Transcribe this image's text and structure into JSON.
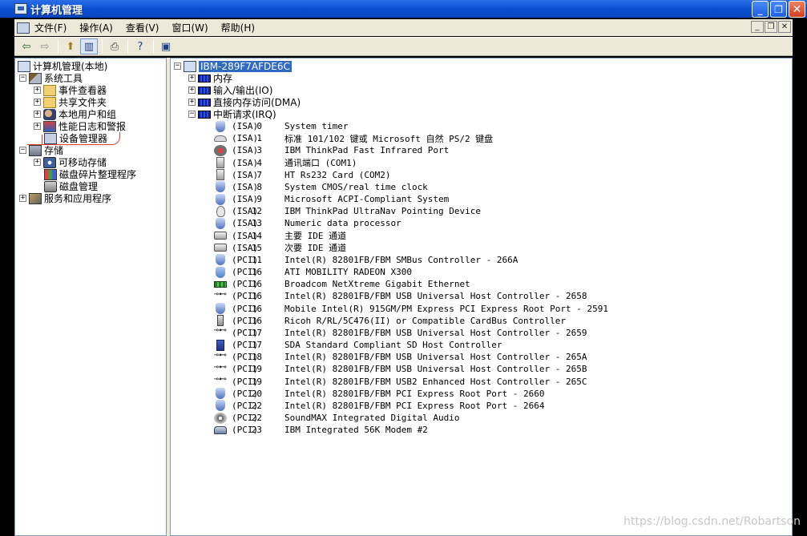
{
  "window": {
    "title": "计算机管理",
    "buttons": {
      "minimize": "_",
      "restore": "❐",
      "close": "✕"
    }
  },
  "menubar": {
    "items": [
      "文件(F)",
      "操作(A)",
      "查看(V)",
      "窗口(W)",
      "帮助(H)"
    ]
  },
  "toolbar": {
    "icons": [
      "back-icon",
      "forward-icon",
      "up-folder-icon",
      "show-hide-tree-icon",
      "print-icon",
      "help-icon",
      "properties-icon"
    ]
  },
  "tree": {
    "root": "计算机管理(本地)",
    "system_tools": "系统工具",
    "event_viewer": "事件查看器",
    "shared_folders": "共享文件夹",
    "local_users": "本地用户和组",
    "perf_logs": "性能日志和警报",
    "device_manager": "设备管理器",
    "storage": "存储",
    "removable_storage": "可移动存储",
    "disk_defrag": "磁盘碎片整理程序",
    "disk_management": "磁盘管理",
    "services_apps": "服务和应用程序"
  },
  "devices": {
    "computer_name": "IBM-289F7AFDE6C",
    "categories": [
      "内存",
      "输入/输出(IO)",
      "直接内存访问(DMA)",
      "中断请求(IRQ)"
    ],
    "irq": [
      {
        "bus": "(ISA)",
        "num": "0",
        "name": "System timer",
        "icon": "generic"
      },
      {
        "bus": "(ISA)",
        "num": "1",
        "name": "标准 101/102 键或 Microsoft 自然 PS/2 键盘",
        "icon": "keyboard"
      },
      {
        "bus": "(ISA)",
        "num": "3",
        "name": "IBM ThinkPad Fast Infrared Port",
        "icon": "ir"
      },
      {
        "bus": "(ISA)",
        "num": "4",
        "name": "通讯端口 (COM1)",
        "icon": "port"
      },
      {
        "bus": "(ISA)",
        "num": "7",
        "name": "HT Rs232 Card (COM2)",
        "icon": "port"
      },
      {
        "bus": "(ISA)",
        "num": "8",
        "name": "System CMOS/real time clock",
        "icon": "generic"
      },
      {
        "bus": "(ISA)",
        "num": "9",
        "name": "Microsoft ACPI-Compliant System",
        "icon": "generic"
      },
      {
        "bus": "(ISA)",
        "num": "12",
        "name": "IBM ThinkPad UltraNav Pointing Device",
        "icon": "mouse"
      },
      {
        "bus": "(ISA)",
        "num": "13",
        "name": "Numeric data processor",
        "icon": "generic"
      },
      {
        "bus": "(ISA)",
        "num": "14",
        "name": "主要 IDE 通道",
        "icon": "ide"
      },
      {
        "bus": "(ISA)",
        "num": "15",
        "name": "次要 IDE 通道",
        "icon": "ide"
      },
      {
        "bus": "(PCI)",
        "num": "11",
        "name": "Intel(R) 82801FB/FBM SMBus Controller - 266A",
        "icon": "generic"
      },
      {
        "bus": "(PCI)",
        "num": "16",
        "name": "ATI MOBILITY RADEON X300",
        "icon": "display"
      },
      {
        "bus": "(PCI)",
        "num": "16",
        "name": "Broadcom NetXtreme Gigabit Ethernet",
        "icon": "net"
      },
      {
        "bus": "(PCI)",
        "num": "16",
        "name": "Intel(R) 82801FB/FBM USB Universal Host Controller - 2658",
        "icon": "usb"
      },
      {
        "bus": "(PCI)",
        "num": "16",
        "name": "Mobile Intel(R) 915GM/PM Express PCI Express Root Port - 2591",
        "icon": "generic"
      },
      {
        "bus": "(PCI)",
        "num": "16",
        "name": "Ricoh R/RL/5C476(II) or Compatible CardBus Controller",
        "icon": "card"
      },
      {
        "bus": "(PCI)",
        "num": "17",
        "name": "Intel(R) 82801FB/FBM USB Universal Host Controller - 2659",
        "icon": "usb"
      },
      {
        "bus": "(PCI)",
        "num": "17",
        "name": "SDA Standard Compliant SD Host Controller",
        "icon": "sd"
      },
      {
        "bus": "(PCI)",
        "num": "18",
        "name": "Intel(R) 82801FB/FBM USB Universal Host Controller - 265A",
        "icon": "usb"
      },
      {
        "bus": "(PCI)",
        "num": "19",
        "name": "Intel(R) 82801FB/FBM USB Universal Host Controller - 265B",
        "icon": "usb"
      },
      {
        "bus": "(PCI)",
        "num": "19",
        "name": "Intel(R) 82801FB/FBM USB2 Enhanced Host Controller - 265C",
        "icon": "usb"
      },
      {
        "bus": "(PCI)",
        "num": "20",
        "name": "Intel(R) 82801FB/FBM PCI Express Root Port - 2660",
        "icon": "generic"
      },
      {
        "bus": "(PCI)",
        "num": "22",
        "name": "Intel(R) 82801FB/FBM PCI Express Root Port - 2664",
        "icon": "generic"
      },
      {
        "bus": "(PCI)",
        "num": "22",
        "name": "SoundMAX Integrated Digital Audio",
        "icon": "sound"
      },
      {
        "bus": "(PCI)",
        "num": "23",
        "name": "IBM Integrated 56K Modem #2",
        "icon": "modem"
      }
    ]
  },
  "watermark": "https://blog.csdn.net/Robartson"
}
